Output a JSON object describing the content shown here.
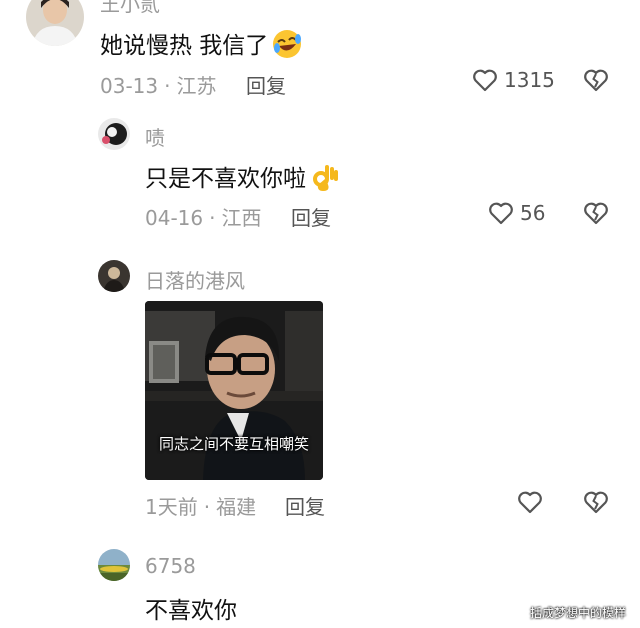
{
  "comments": [
    {
      "username": "王小贰",
      "text": "她说慢热 我信了",
      "emoji": "rolling-laugh-emoji",
      "date": "03-13",
      "location": "江苏",
      "reply_label": "回复",
      "likes": "1315"
    },
    {
      "username": "啧",
      "text": "只是不喜欢你啦",
      "emoji": "ok-hand-emoji",
      "date": "04-16",
      "location": "江西",
      "reply_label": "回复",
      "likes": "56"
    },
    {
      "username": "日落的港风",
      "image_caption": "同志之间不要互相嘲笑",
      "date": "1天前",
      "location": "福建",
      "reply_label": "回复",
      "likes": ""
    },
    {
      "username": "6758",
      "text": "不喜欢你"
    }
  ],
  "separator": "·",
  "watermark": "括成梦想中的模样",
  "colors": {
    "meta_gray": "#9a9a9a",
    "icon_gray": "#555555"
  }
}
